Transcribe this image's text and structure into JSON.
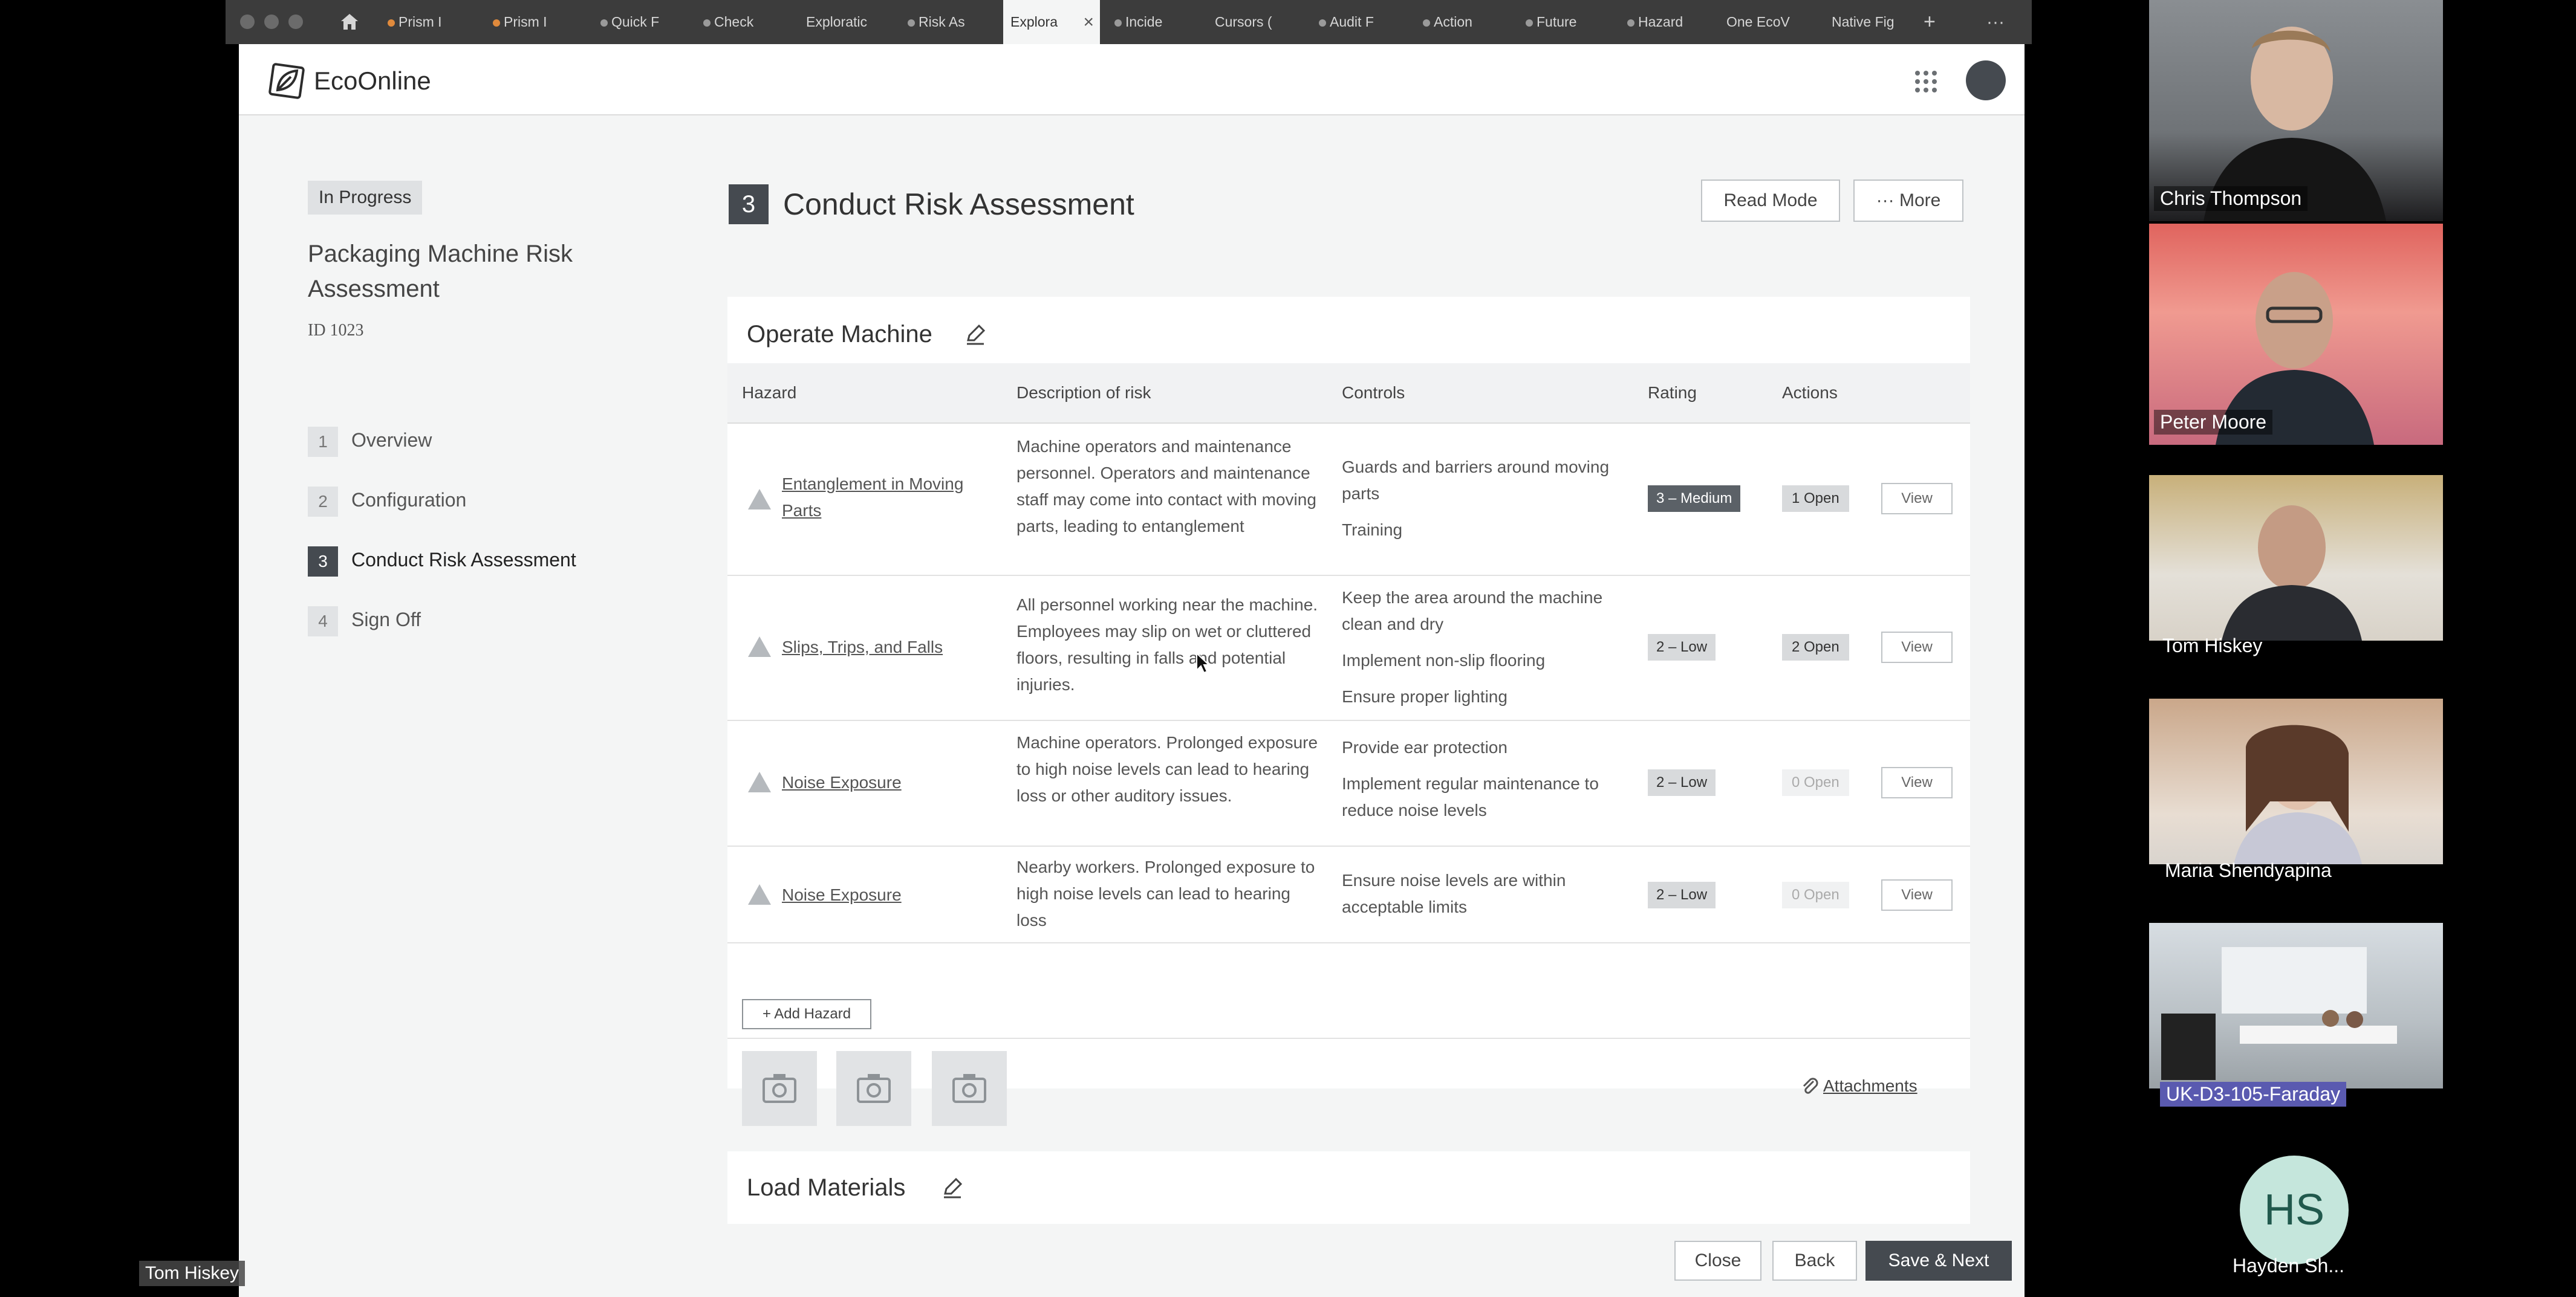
{
  "browser": {
    "tabs": [
      {
        "label": "Prism I",
        "icon": "rainbow-icon"
      },
      {
        "label": "Prism I",
        "icon": "rainbow-icon"
      },
      {
        "label": "Quick F",
        "icon": "dot-icon"
      },
      {
        "label": "Check",
        "icon": "dot-icon"
      },
      {
        "label": "Exploratic",
        "icon": ""
      },
      {
        "label": "Risk As",
        "icon": "dot-icon"
      },
      {
        "label": "Explora",
        "icon": "",
        "active": true
      },
      {
        "label": "Incide",
        "icon": "dot-icon"
      },
      {
        "label": "Cursors (",
        "icon": ""
      },
      {
        "label": "Audit F",
        "icon": "dot-icon"
      },
      {
        "label": "Action",
        "icon": "dot-icon"
      },
      {
        "label": "Future",
        "icon": "dot-icon"
      },
      {
        "label": "Hazard",
        "icon": "dot-icon"
      },
      {
        "label": "One EcoV",
        "icon": ""
      },
      {
        "label": "Native Fig",
        "icon": ""
      }
    ],
    "new_tab": "+",
    "more": "···",
    "close_tab": "×"
  },
  "app": {
    "name": "EcoOnline"
  },
  "assessment": {
    "status": "In Progress",
    "title": "Packaging Machine Risk Assessment",
    "id": "ID 1023",
    "steps": [
      {
        "num": "1",
        "label": "Overview"
      },
      {
        "num": "2",
        "label": "Configuration"
      },
      {
        "num": "3",
        "label": "Conduct Risk Assessment",
        "active": true
      },
      {
        "num": "4",
        "label": "Sign Off"
      }
    ]
  },
  "main": {
    "step_num": "3",
    "title": "Conduct Risk Assessment",
    "read_mode": "Read Mode",
    "more": "··· More"
  },
  "section": {
    "name": "Operate Machine",
    "columns": {
      "hazard": "Hazard",
      "description": "Description of risk",
      "controls": "Controls",
      "rating": "Rating",
      "actions": "Actions"
    },
    "rows": [
      {
        "hazard": "Entanglement in Moving Parts",
        "description": "Machine operators and maintenance personnel. Operators and maintenance staff may come into contact with moving parts, leading to entanglement",
        "controls": [
          "Guards and barriers around moving parts",
          "Training"
        ],
        "rating": "3 – Medium",
        "actions": "1 Open",
        "view": "View"
      },
      {
        "hazard": "Slips, Trips, and Falls",
        "description": "All personnel working near the machine. Employees may slip on wet or cluttered floors, resulting in falls and potential injuries.",
        "controls": [
          "Keep the area around the machine clean and dry",
          "Implement non-slip flooring",
          "Ensure proper lighting"
        ],
        "rating": "2 – Low",
        "actions": "2 Open",
        "view": "View"
      },
      {
        "hazard": "Noise Exposure",
        "description": "Machine operators. Prolonged exposure to high noise levels can lead to hearing loss or other auditory issues.",
        "controls": [
          "Provide ear protection",
          "Implement regular maintenance to reduce noise levels"
        ],
        "rating": "2 – Low",
        "actions": "0 Open",
        "view": "View"
      },
      {
        "hazard": "Noise Exposure",
        "description": "Nearby workers. Prolonged exposure to high noise levels can lead to hearing loss",
        "controls": [
          "Ensure noise levels are within acceptable limits"
        ],
        "rating": "2 – Low",
        "actions": "0 Open",
        "view": "View"
      }
    ],
    "add_hazard": "+ Add Hazard",
    "attachments": "Attachments"
  },
  "section2": {
    "name": "Load Materials"
  },
  "footer": {
    "close": "Close",
    "back": "Back",
    "save_next": "Save & Next"
  },
  "participants": [
    {
      "name": "Chris Thompson"
    },
    {
      "name": "Peter Moore"
    },
    {
      "name": "Tom Hiskey"
    },
    {
      "name": "Maria Shendyapina"
    },
    {
      "name": "UK-D3-105-Faraday"
    },
    {
      "name": "Hayden Sh...",
      "initials": "HS"
    }
  ],
  "self_view": {
    "name": "Tom Hiskey"
  },
  "colors": {
    "accent": "#454a50",
    "badge_medium": "#5b6167",
    "tile_bg_hs": "#c5e6dc",
    "hs_text": "#21594d"
  }
}
